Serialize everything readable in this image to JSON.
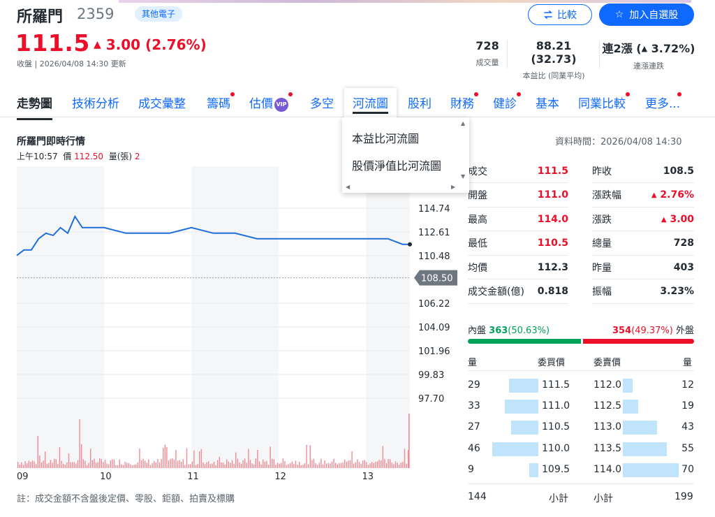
{
  "header": {
    "name": "所羅門",
    "code": "2359",
    "sector": "其他電子",
    "compare_label": "比較",
    "watch_label": "加入自選股",
    "price": "111.5",
    "change": "3.00 (2.76%)",
    "close_info": "收盤 | 2026/04/08 14:30 更新",
    "stats": [
      {
        "value": "728",
        "label": "成交量"
      },
      {
        "value": "88.21 (32.73)",
        "label": "本益比 (同業平均)"
      },
      {
        "value_prefix": "連2漲 (",
        "value_pct": "3.72%)",
        "label": "連漲連跌"
      }
    ]
  },
  "tabs": [
    {
      "label": "走勢圖",
      "active": true
    },
    {
      "label": "技術分析"
    },
    {
      "label": "成交彙整"
    },
    {
      "label": "籌碼",
      "dot": true
    },
    {
      "label": "估價",
      "badge": "VIP",
      "dot": true
    },
    {
      "label": "多空"
    },
    {
      "label": "河流圖",
      "open": true
    },
    {
      "label": "股利"
    },
    {
      "label": "財務",
      "dot": true
    },
    {
      "label": "健診",
      "dot": true
    },
    {
      "label": "基本"
    },
    {
      "label": "同業比較",
      "dot": true
    },
    {
      "label": "更多...",
      "dot": true
    }
  ],
  "dropdown": [
    "本益比河流圖",
    "股價淨值比河流圖"
  ],
  "chart_panel": {
    "title": "所羅門即時行情",
    "info_time": "上午10:57",
    "info_price_label": "價",
    "info_price": "112.50",
    "info_vol_label": "量(張)",
    "info_vol": "2",
    "data_time": "資料時間：2026/04/08 14:30",
    "note": "註：成交金額不含盤後定價、零股、鉅額、拍賣及標購"
  },
  "chart_data": {
    "type": "line",
    "x_ticks": [
      "09",
      "10",
      "11",
      "12",
      "13"
    ],
    "y_ticks": [
      114.74,
      112.61,
      110.48,
      108.5,
      106.22,
      104.09,
      101.96,
      99.83,
      97.7
    ],
    "prev_close": 108.5,
    "ylim": [
      97.7,
      114.74
    ],
    "x": [
      "09:00",
      "09:05",
      "09:10",
      "09:15",
      "09:20",
      "09:25",
      "09:30",
      "09:35",
      "09:40",
      "09:45",
      "09:50",
      "10:00",
      "10:15",
      "10:30",
      "10:45",
      "11:00",
      "11:15",
      "11:30",
      "11:45",
      "12:00",
      "12:15",
      "12:30",
      "12:45",
      "13:00",
      "13:15",
      "13:25",
      "13:30"
    ],
    "y": [
      110.5,
      111.0,
      111.0,
      112.0,
      112.5,
      112.3,
      113.0,
      112.5,
      114.0,
      113.0,
      113.0,
      113.0,
      112.5,
      112.5,
      112.5,
      113.0,
      112.5,
      112.5,
      112.0,
      112.0,
      112.0,
      112.0,
      112.0,
      112.0,
      112.0,
      111.5,
      111.5
    ],
    "volume_note": "intraday volume bars"
  },
  "quote": {
    "left": [
      {
        "k": "成交",
        "v": "111.5",
        "color": "red"
      },
      {
        "k": "開盤",
        "v": "111.0",
        "color": "red"
      },
      {
        "k": "最高",
        "v": "114.0",
        "color": "red"
      },
      {
        "k": "最低",
        "v": "110.5",
        "color": "red"
      },
      {
        "k": "均價",
        "v": "112.3",
        "color": "black"
      },
      {
        "k": "成交金額(億)",
        "v": "0.818",
        "color": "black"
      }
    ],
    "right": [
      {
        "k": "昨收",
        "v": "108.5",
        "color": "black"
      },
      {
        "k": "漲跌幅",
        "v": "2.76%",
        "color": "red",
        "arrow": true
      },
      {
        "k": "漲跌",
        "v": "3.00",
        "color": "red",
        "arrow": true
      },
      {
        "k": "總量",
        "v": "728",
        "color": "black"
      },
      {
        "k": "昨量",
        "v": "403",
        "color": "black"
      },
      {
        "k": "振幅",
        "v": "3.23%",
        "color": "black"
      }
    ]
  },
  "inout": {
    "in_label": "內盤",
    "in_value": "363",
    "in_pct": "(50.63%)",
    "out_value": "354",
    "out_pct": "(49.37%)",
    "out_label": "外盤",
    "in_ratio": 0.5063
  },
  "orderbook": {
    "head": [
      "量",
      "委買價",
      "委賣價",
      "量"
    ],
    "bids": [
      {
        "qty": "29",
        "price": "111.5",
        "ratio": 0.63
      },
      {
        "qty": "33",
        "price": "111.0",
        "ratio": 0.72
      },
      {
        "qty": "27",
        "price": "110.5",
        "ratio": 0.59
      },
      {
        "qty": "46",
        "price": "110.0",
        "ratio": 1.0
      },
      {
        "qty": "9",
        "price": "109.5",
        "ratio": 0.2
      }
    ],
    "asks": [
      {
        "price": "112.0",
        "qty": "12",
        "ratio": 0.17
      },
      {
        "price": "112.5",
        "qty": "19",
        "ratio": 0.27
      },
      {
        "price": "113.0",
        "qty": "43",
        "ratio": 0.61
      },
      {
        "price": "113.5",
        "qty": "55",
        "ratio": 0.79
      },
      {
        "price": "114.0",
        "qty": "70",
        "ratio": 1.0
      }
    ],
    "bid_total": "144",
    "bid_total_label": "小計",
    "ask_total_label": "小計",
    "ask_total": "199"
  },
  "colors": {
    "up": "#eb0f29",
    "down": "#00a35a",
    "accent": "#0f69ff",
    "line": "#1e6fd9"
  }
}
